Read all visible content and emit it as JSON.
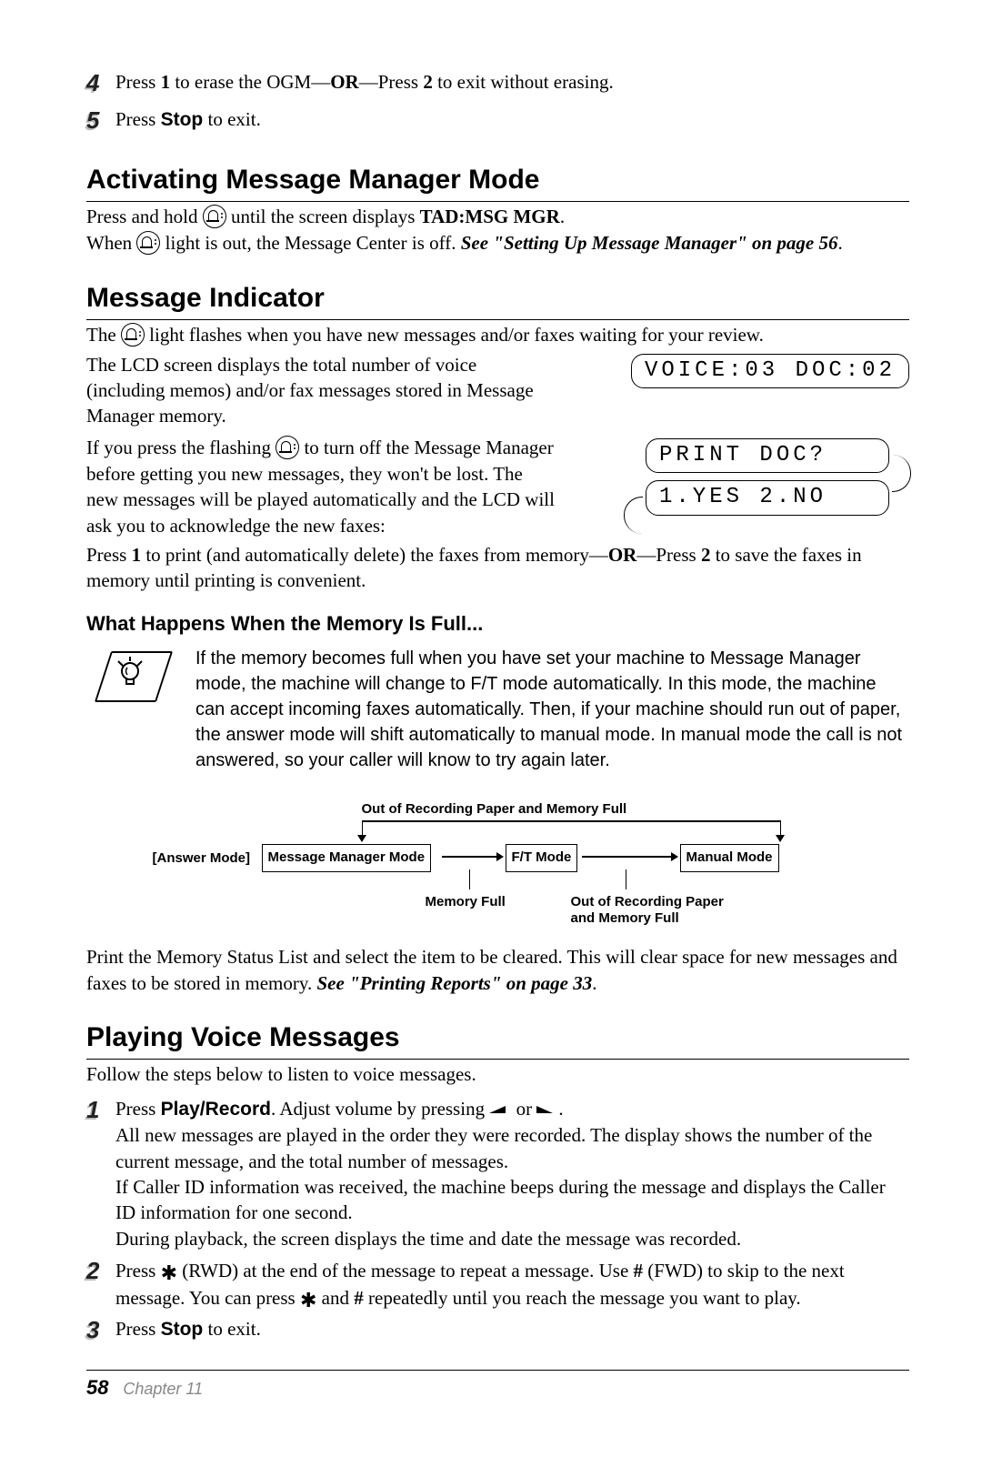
{
  "step4": {
    "num": "4",
    "a": "Press ",
    "key1": "1",
    "b": " to erase the OGM—",
    "or": "OR",
    "c": "—Press ",
    "key2": "2",
    "d": " to exit without erasing."
  },
  "step5": {
    "num": "5",
    "a": "Press ",
    "stop": "Stop",
    "b": " to exit."
  },
  "h_activating": "Activating Message Manager Mode",
  "act": {
    "a": "Press and hold ",
    "b": " until the screen displays ",
    "tad": "TAD:MSG MGR",
    "c": ".",
    "d": "When ",
    "e": " light is out, the Message Center is off. ",
    "see": "See \"Setting Up Message Manager\" on page 56",
    "f": "."
  },
  "h_indicator": "Message Indicator",
  "ind": {
    "p1a": "The ",
    "p1b": " light flashes when you have new messages and/or faxes waiting for your review.",
    "p2": "The LCD screen displays the total number of voice (including memos) and/or fax messages stored in Message Manager memory.",
    "lcd1": "VOICE:03 DOC:02",
    "p3a": "If you press the flashing ",
    "p3b": " to turn off the Message Manager before getting you new messages, they won't be lost. The new messages will be played automatically and the LCD will ask you to acknowledge the new faxes:",
    "lcd2": "PRINT DOC?",
    "lcd3": "1.YES 2.NO",
    "p4a": "Press ",
    "p4b": " to print (and automatically delete) the faxes from memory—",
    "p4c": "—Press ",
    "p4d": " to save the faxes in memory until printing is convenient.",
    "key1": "1",
    "or": "OR",
    "key2": "2"
  },
  "h_memfull": "What Happens When the Memory Is Full...",
  "memfull_tip": "If the memory becomes full when you have set your machine to Message Manager mode, the machine will change to F/T mode automatically. In this mode, the machine can accept incoming faxes automatically. Then, if your machine should run out of paper, the answer mode will shift automatically to manual mode. In manual mode the call is not answered, so your caller will know to try again later.",
  "diagram": {
    "top_label": "Out of Recording Paper and Memory Full",
    "ans_label": "[Answer Mode]",
    "box1": "Message Manager Mode",
    "box2": "F/T Mode",
    "box3": "Manual Mode",
    "under1": "Memory Full",
    "under2a": "Out of Recording Paper",
    "under2b": "and Memory Full"
  },
  "memo_p": {
    "a": "Print the Memory Status List and select the item to be cleared. This will clear space for new messages and faxes to be stored in memory. ",
    "see": "See \"Printing Reports\" on page 33",
    "b": "."
  },
  "h_playing": "Playing Voice Messages",
  "play_intro": "Follow the steps below to listen to voice messages.",
  "play1": {
    "num": "1",
    "a": "Press ",
    "pr": "Play/Record",
    "b": ". Adjust volume by pressing ",
    "or": " or ",
    "c": ".",
    "d": "All new messages are played in the order they were recorded. The display shows the number of the current message, and the total number of messages.",
    "e": "If Caller ID information was received, the machine beeps during the message and displays the Caller ID information for one second.",
    "f": "During playback, the screen displays the time and date the message was recorded."
  },
  "play2": {
    "num": "2",
    "a": "Press ",
    "b": " (RWD) at the end of the message to repeat a message. Use ",
    "hash": "#",
    "c": " (FWD) to skip to the next message. You can press ",
    "d": " and ",
    "e": " repeatedly until you reach the message you want to play."
  },
  "play3": {
    "num": "3",
    "a": "Press ",
    "stop": "Stop",
    "b": " to exit."
  },
  "footer": {
    "page": "58",
    "chapter": "Chapter 11"
  }
}
